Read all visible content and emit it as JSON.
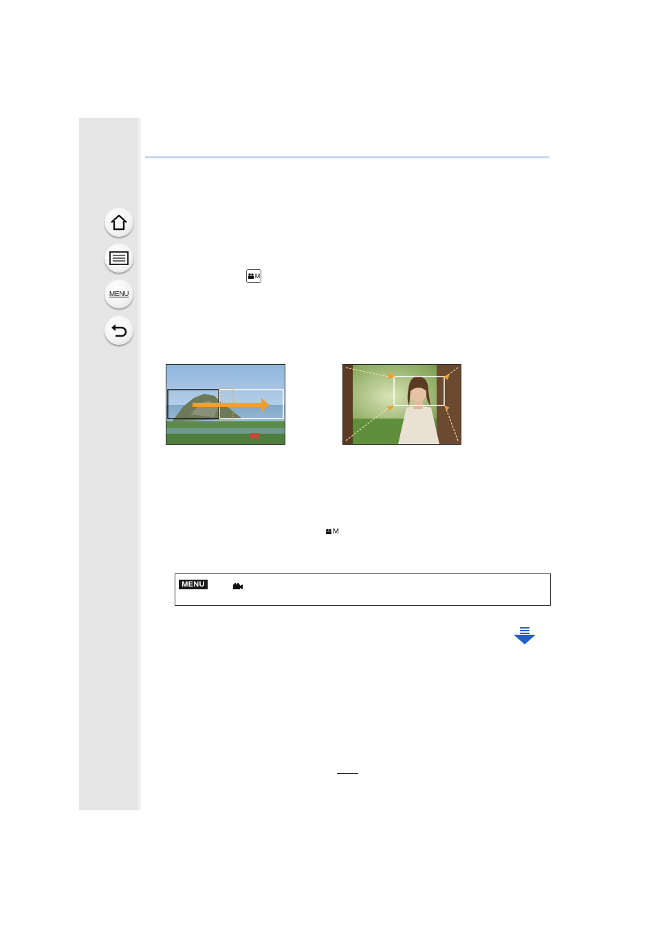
{
  "sidebar": {
    "nav": [
      {
        "name": "home-icon"
      },
      {
        "name": "contents-list-icon"
      },
      {
        "name": "menu-icon",
        "label": "MENU"
      },
      {
        "name": "back-icon"
      }
    ]
  },
  "body_icons": {
    "movie_mode_icon_1": {
      "icon": "creative-video-mode-icon",
      "label": "M"
    },
    "movie_mode_icon_2": {
      "icon": "creative-video-mode-icon",
      "label": "M"
    }
  },
  "menu_path": {
    "badge": "MENU",
    "icon": "motion-picture-menu-icon"
  },
  "colors": {
    "sidebar_bg": "#e6e6e6",
    "rule": "#c7d7e8",
    "arrow_orange": "#f0a030",
    "next_page_blue": "#1f5fc8"
  },
  "next_page_icon": "next-page-arrow-icon"
}
